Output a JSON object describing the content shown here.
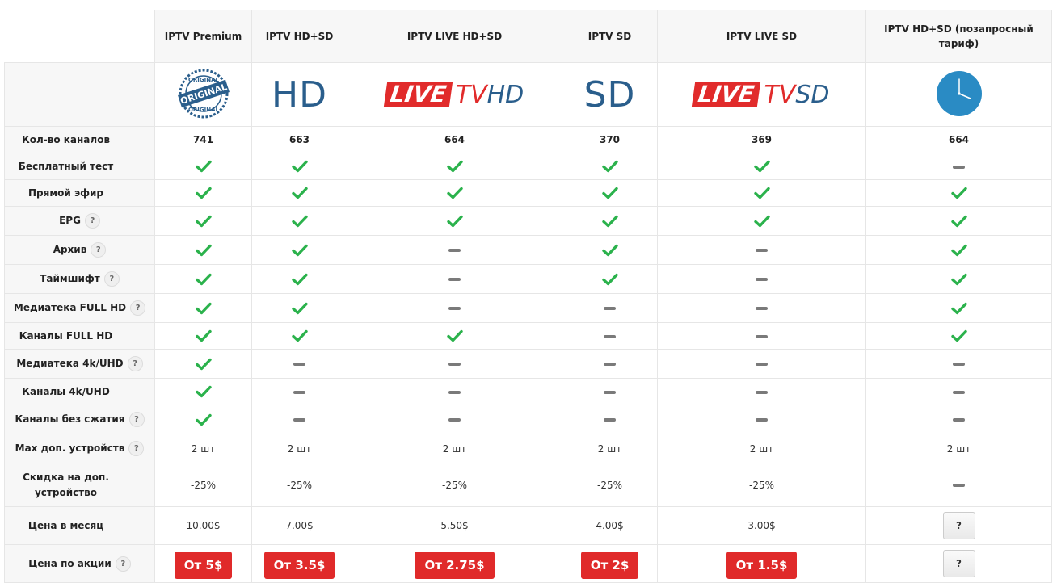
{
  "plans": [
    "IPTV Premium",
    "IPTV HD+SD",
    "IPTV LIVE HD+SD",
    "IPTV SD",
    "IPTV LIVE SD",
    "IPTV HD+SD (позапросный тариф)"
  ],
  "logos": {
    "original_top": "ORIGINAL",
    "original_mid": "ORIGINAL",
    "original_bottom": "ORIGINAL",
    "hd": "HD",
    "sd": "SD",
    "live": "LIVE",
    "tv": "TV",
    "hd_suffix": "HD",
    "sd_suffix": "SD"
  },
  "features": [
    {
      "label": "Кол-во каналов",
      "help": false,
      "kind": "num",
      "values": [
        "741",
        "663",
        "664",
        "370",
        "369",
        "664"
      ]
    },
    {
      "label": "Бесплатный тест",
      "help": false,
      "kind": "bool",
      "values": [
        true,
        true,
        true,
        true,
        true,
        false
      ]
    },
    {
      "label": "Прямой эфир",
      "help": false,
      "kind": "bool",
      "values": [
        true,
        true,
        true,
        true,
        true,
        true
      ]
    },
    {
      "label": "EPG",
      "help": true,
      "kind": "bool",
      "values": [
        true,
        true,
        true,
        true,
        true,
        true
      ]
    },
    {
      "label": "Архив",
      "help": true,
      "kind": "bool",
      "values": [
        true,
        true,
        false,
        true,
        false,
        true
      ]
    },
    {
      "label": "Таймшифт",
      "help": true,
      "kind": "bool",
      "values": [
        true,
        true,
        false,
        true,
        false,
        true
      ]
    },
    {
      "label": "Медиатека FULL HD",
      "help": true,
      "kind": "bool",
      "values": [
        true,
        true,
        false,
        false,
        false,
        true
      ]
    },
    {
      "label": "Каналы FULL HD",
      "help": false,
      "kind": "bool",
      "values": [
        true,
        true,
        true,
        false,
        false,
        true
      ]
    },
    {
      "label": "Медиатека 4k/UHD",
      "help": true,
      "kind": "bool",
      "values": [
        true,
        false,
        false,
        false,
        false,
        false
      ]
    },
    {
      "label": "Каналы 4k/UHD",
      "help": false,
      "kind": "bool",
      "values": [
        true,
        false,
        false,
        false,
        false,
        false
      ]
    },
    {
      "label": "Каналы без сжатия",
      "help": true,
      "kind": "bool",
      "values": [
        true,
        false,
        false,
        false,
        false,
        false
      ]
    },
    {
      "label": "Max доп. устройств",
      "help": true,
      "kind": "text",
      "values": [
        "2 шт",
        "2 шт",
        "2 шт",
        "2 шт",
        "2 шт",
        "2 шт"
      ]
    },
    {
      "label": "Скидка на доп. устройство",
      "help": false,
      "kind": "text",
      "values": [
        "-25%",
        "-25%",
        "-25%",
        "-25%",
        "-25%",
        null
      ]
    },
    {
      "label": "Цена в месяц",
      "help": false,
      "kind": "text",
      "values": [
        "10.00$",
        "7.00$",
        "5.50$",
        "4.00$",
        "3.00$",
        "?btn"
      ]
    },
    {
      "label": "Цена по акции",
      "help": true,
      "kind": "promo",
      "values": [
        "От 5$",
        "От 3.5$",
        "От 2.75$",
        "От 2$",
        "От 1.5$",
        "?btn"
      ]
    }
  ],
  "help_glyph": "?",
  "request_button_label": "?",
  "colors": {
    "check": "#2bb24c",
    "dash": "#7a7a7a",
    "promo": "#e02a2a",
    "logo_blue": "#2a5e8c",
    "clock": "#2a8bc4"
  }
}
